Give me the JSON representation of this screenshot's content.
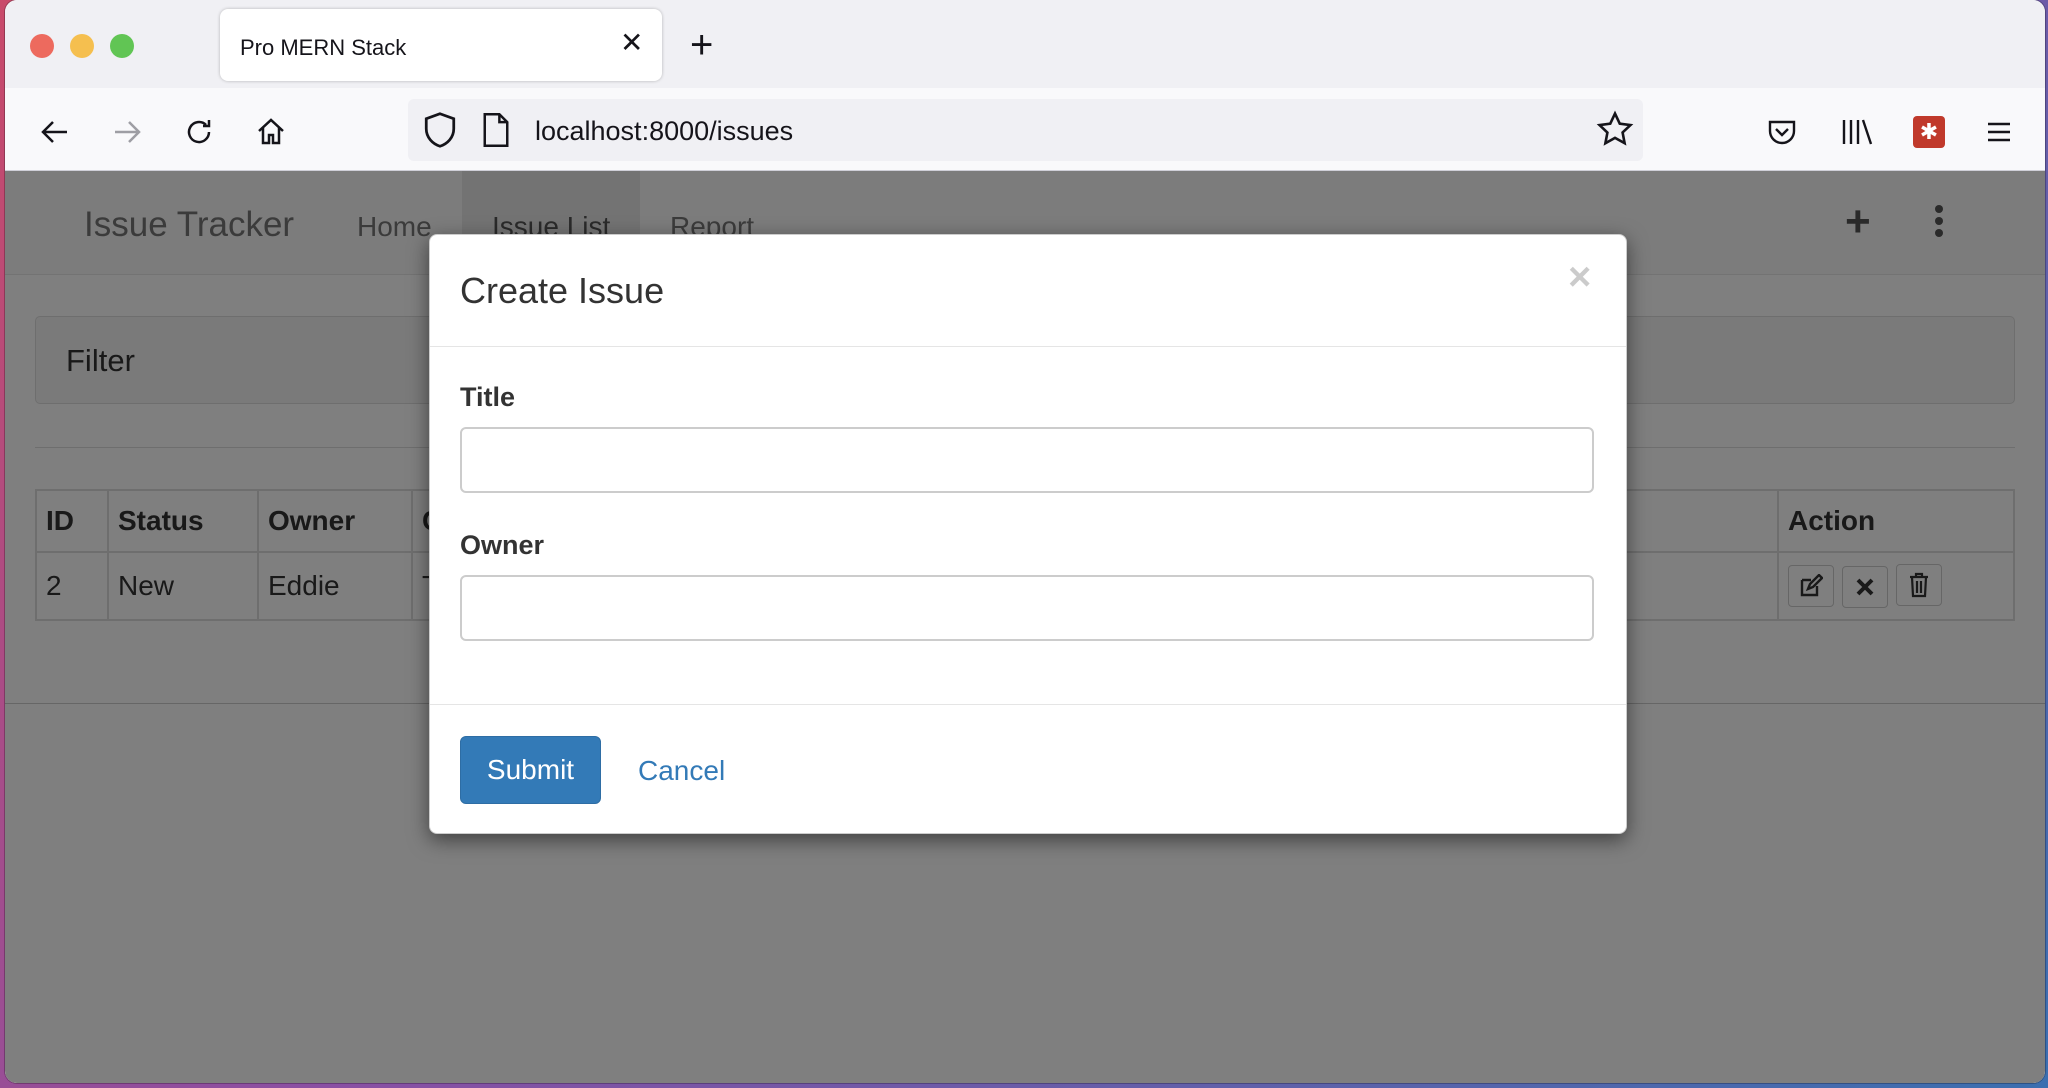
{
  "browser": {
    "tab_title": "Pro MERN Stack",
    "url": "localhost:8000/issues"
  },
  "navbar": {
    "brand": "Issue Tracker",
    "links": [
      "Home",
      "Issue List",
      "Report"
    ]
  },
  "filter": {
    "title": "Filter"
  },
  "table": {
    "headers": [
      "ID",
      "Status",
      "Owner",
      "C",
      "Action"
    ],
    "row": {
      "id": "2",
      "status": "New",
      "owner": "Eddie",
      "partial": "T"
    }
  },
  "modal": {
    "title": "Create Issue",
    "close": "×",
    "title_label": "Title",
    "title_value": "",
    "owner_label": "Owner",
    "owner_value": "",
    "submit_label": "Submit",
    "cancel_label": "Cancel"
  },
  "colors": {
    "primary": "#337ab7",
    "traffic_red": "#ed6a5e",
    "traffic_yellow": "#f5bf4f",
    "traffic_green": "#61c554"
  }
}
